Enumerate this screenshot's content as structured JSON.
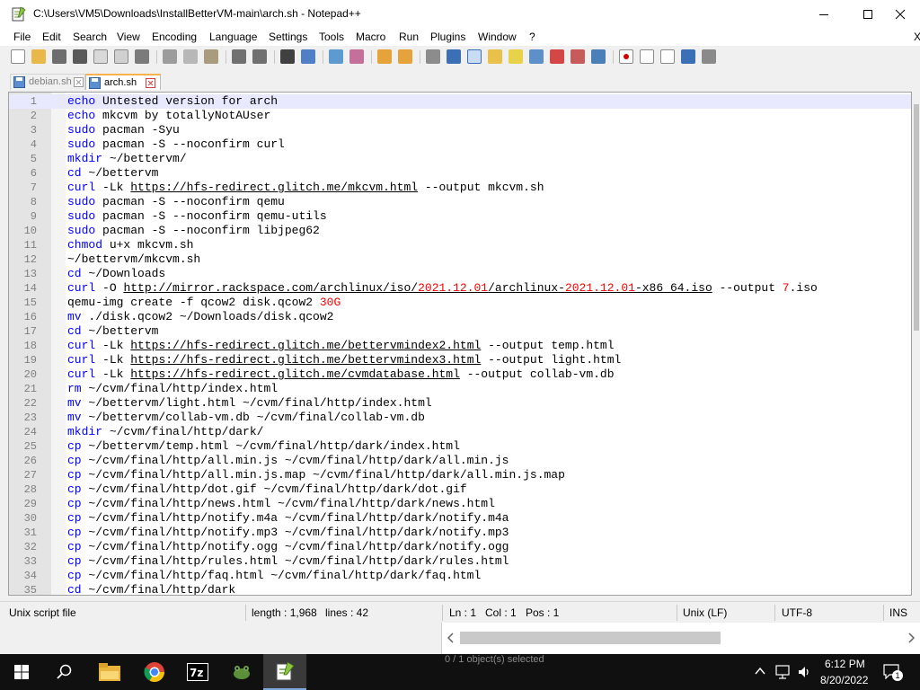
{
  "window": {
    "title": "C:\\Users\\VM5\\Downloads\\InstallBetterVM-main\\arch.sh - Notepad++",
    "app_icon": "notepadpp-icon",
    "controls": [
      "minimize-icon",
      "maximize-icon",
      "close-icon"
    ]
  },
  "menu": {
    "items": [
      "File",
      "Edit",
      "Search",
      "View",
      "Encoding",
      "Language",
      "Settings",
      "Tools",
      "Macro",
      "Run",
      "Plugins",
      "Window",
      "?"
    ],
    "close_doc": "X"
  },
  "toolbar": {
    "icons": [
      "new-file-icon",
      "open-file-icon",
      "save-icon",
      "save-all-icon",
      "close-icon",
      "close-all-icon",
      "print-icon",
      "cut-icon",
      "copy-icon",
      "paste-icon",
      "undo-icon",
      "redo-icon",
      "find-icon",
      "replace-icon",
      "zoom-in-icon",
      "zoom-out-icon",
      "sync-vertical-icon",
      "sync-horizontal-icon",
      "word-wrap-icon",
      "show-all-chars-icon",
      "indent-guide-icon",
      "user-language-icon",
      "document-map-icon",
      "function-list-icon",
      "folder-workspace-icon",
      "monitoring-icon",
      "record-macro-icon",
      "stop-record-icon",
      "play-macro-icon",
      "run-macro-multiple-icon",
      "save-macro-icon"
    ]
  },
  "tabs": [
    {
      "label": "debian.sh",
      "active": false
    },
    {
      "label": "arch.sh",
      "active": true
    }
  ],
  "editor": {
    "current_line": 1,
    "lines": [
      {
        "n": "1",
        "kw": "echo",
        "rest": " Untested version for arch"
      },
      {
        "n": "2",
        "kw": "echo",
        "rest": " mkcvm by totallyNotAUser"
      },
      {
        "n": "3",
        "kw": "sudo",
        "rest": " pacman -Syu"
      },
      {
        "n": "4",
        "kw": "sudo",
        "rest": " pacman -S --noconfirm curl"
      },
      {
        "n": "5",
        "kw": "mkdir",
        "rest": " ~/bettervm/"
      },
      {
        "n": "6",
        "kw": "cd",
        "rest": " ~/bettervm"
      },
      {
        "n": "7",
        "kw": "curl",
        "rest": " -Lk https://hfs-redirect.glitch.me/mkcvm.html --output mkcvm.sh"
      },
      {
        "n": "8",
        "kw": "sudo",
        "rest": " pacman -S --noconfirm qemu"
      },
      {
        "n": "9",
        "kw": "sudo",
        "rest": " pacman -S --noconfirm qemu-utils"
      },
      {
        "n": "10",
        "kw": "sudo",
        "rest": " pacman -S --noconfirm libjpeg62"
      },
      {
        "n": "11",
        "kw": "chmod",
        "rest": " u+x mkcvm.sh"
      },
      {
        "n": "12",
        "kw": "",
        "rest": "~/bettervm/mkcvm.sh"
      },
      {
        "n": "13",
        "kw": "cd",
        "rest": " ~/Downloads"
      },
      {
        "n": "14",
        "kw": "curl",
        "rest": " -O http://mirror.rackspace.com/archlinux/iso/2021.12.01/archlinux-2021.12.01-x86_64.iso --output 7.iso"
      },
      {
        "n": "15",
        "kw": "",
        "rest": "qemu-img create -f qcow2 disk.qcow2 30G"
      },
      {
        "n": "16",
        "kw": "mv",
        "rest": " ./disk.qcow2 ~/Downloads/disk.qcow2"
      },
      {
        "n": "17",
        "kw": "cd",
        "rest": " ~/bettervm"
      },
      {
        "n": "18",
        "kw": "curl",
        "rest": " -Lk https://hfs-redirect.glitch.me/bettervmindex2.html --output temp.html"
      },
      {
        "n": "19",
        "kw": "curl",
        "rest": " -Lk https://hfs-redirect.glitch.me/bettervmindex3.html --output light.html"
      },
      {
        "n": "20",
        "kw": "curl",
        "rest": " -Lk https://hfs-redirect.glitch.me/cvmdatabase.html --output collab-vm.db"
      },
      {
        "n": "21",
        "kw": "rm",
        "rest": " ~/cvm/final/http/index.html"
      },
      {
        "n": "22",
        "kw": "mv",
        "rest": " ~/bettervm/light.html ~/cvm/final/http/index.html"
      },
      {
        "n": "23",
        "kw": "mv",
        "rest": " ~/bettervm/collab-vm.db ~/cvm/final/collab-vm.db"
      },
      {
        "n": "24",
        "kw": "mkdir",
        "rest": " ~/cvm/final/http/dark/"
      },
      {
        "n": "25",
        "kw": "cp",
        "rest": " ~/bettervm/temp.html ~/cvm/final/http/dark/index.html"
      },
      {
        "n": "26",
        "kw": "cp",
        "rest": " ~/cvm/final/http/all.min.js ~/cvm/final/http/dark/all.min.js"
      },
      {
        "n": "27",
        "kw": "cp",
        "rest": " ~/cvm/final/http/all.min.js.map ~/cvm/final/http/dark/all.min.js.map"
      },
      {
        "n": "28",
        "kw": "cp",
        "rest": " ~/cvm/final/http/dot.gif ~/cvm/final/http/dark/dot.gif"
      },
      {
        "n": "29",
        "kw": "cp",
        "rest": " ~/cvm/final/http/news.html ~/cvm/final/http/dark/news.html"
      },
      {
        "n": "30",
        "kw": "cp",
        "rest": " ~/cvm/final/http/notify.m4a ~/cvm/final/http/dark/notify.m4a"
      },
      {
        "n": "31",
        "kw": "cp",
        "rest": " ~/cvm/final/http/notify.mp3 ~/cvm/final/http/dark/notify.mp3"
      },
      {
        "n": "32",
        "kw": "cp",
        "rest": " ~/cvm/final/http/notify.ogg ~/cvm/final/http/dark/notify.ogg"
      },
      {
        "n": "33",
        "kw": "cp",
        "rest": " ~/cvm/final/http/rules.html ~/cvm/final/http/dark/rules.html"
      },
      {
        "n": "34",
        "kw": "cp",
        "rest": " ~/cvm/final/http/faq.html ~/cvm/final/http/dark/faq.html"
      },
      {
        "n": "35",
        "kw": "cd",
        "rest": " ~/cvm/final/http/dark"
      }
    ]
  },
  "status": {
    "file_type": "Unix script file",
    "length": "length : 1,968",
    "lines": "lines : 42",
    "ln": "Ln : 1",
    "col": "Col : 1",
    "pos": "Pos : 1",
    "eol": "Unix (LF)",
    "encoding": "UTF-8",
    "mode": "INS"
  },
  "background_window": {
    "status_text": "0 / 1 object(s) selected"
  },
  "taskbar": {
    "icons": [
      "windows-start-icon",
      "search-icon",
      "file-explorer-icon",
      "chrome-icon",
      "7zip-icon",
      "frog-app-icon",
      "notepadpp-icon"
    ],
    "time": "6:12 PM",
    "date": "8/20/2022",
    "notifications": "1",
    "colors": {
      "taskbar": "#101010",
      "tab_accent": "#fab24c",
      "keyword": "#0000ff",
      "number": "#ff0000"
    }
  }
}
